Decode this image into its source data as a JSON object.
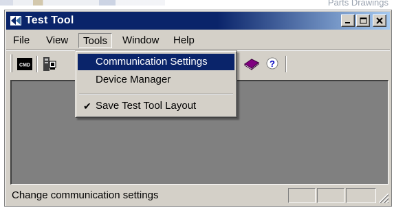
{
  "desktop": {
    "background_text": "Parts Drawings"
  },
  "window": {
    "title": "Test Tool",
    "title_icon": "app-icon",
    "caption_buttons": {
      "minimize": "minimize-icon",
      "maximize": "maximize-icon",
      "close": "close-icon"
    }
  },
  "menubar": {
    "items": [
      {
        "label": "File"
      },
      {
        "label": "View"
      },
      {
        "label": "Tools",
        "open": true
      },
      {
        "label": "Window"
      },
      {
        "label": "Help"
      }
    ]
  },
  "toolbar": {
    "buttons": [
      {
        "icon": "cmd-icon",
        "glyph": "CMD"
      },
      {
        "icon": "device-icon"
      },
      {
        "icon": "book-icon"
      },
      {
        "icon": "help-icon",
        "glyph": "?"
      }
    ]
  },
  "tools_menu": {
    "items": [
      {
        "label": "Communication Settings",
        "highlighted": true
      },
      {
        "label": "Device Manager"
      },
      {
        "label": "Save Test Tool Layout",
        "checked": true,
        "check_glyph": "✔"
      }
    ]
  },
  "statusbar": {
    "text": "Change communication settings"
  },
  "colors": {
    "titlebar_start": "#0a246a",
    "titlebar_end": "#a6caf0",
    "face": "#d4d0c8",
    "client": "#808080",
    "highlight": "#0a246a"
  }
}
